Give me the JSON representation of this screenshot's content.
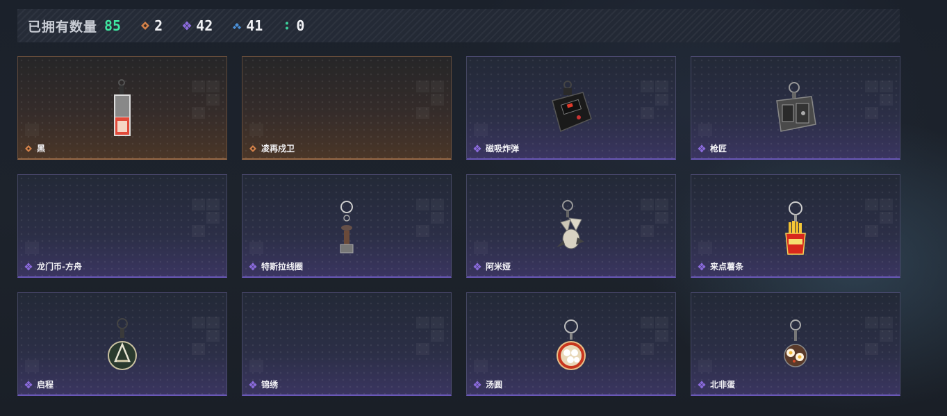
{
  "header": {
    "title": "已拥有数量",
    "total": "85",
    "stats": [
      {
        "icon": "orange-diamond-icon",
        "color": "#d4824a",
        "value": "2"
      },
      {
        "icon": "purple-diamond-icon",
        "color": "#8b6bdc",
        "value": "42"
      },
      {
        "icon": "blue-chevron-icon",
        "color": "#4a8fd8",
        "value": "41"
      },
      {
        "icon": "green-dots-icon",
        "color": "#3ccf9a",
        "value": "0"
      }
    ]
  },
  "items": [
    {
      "name": "黑",
      "rarity": "orange",
      "art": "card-keychain"
    },
    {
      "name": "凌再戍卫",
      "rarity": "orange",
      "art": "none"
    },
    {
      "name": "磁吸炸弹",
      "rarity": "purple",
      "art": "bomb-keychain"
    },
    {
      "name": "枪匠",
      "rarity": "purple",
      "art": "case-keychain"
    },
    {
      "name": "龙门币-方舟",
      "rarity": "purple",
      "art": "none"
    },
    {
      "name": "特斯拉线圈",
      "rarity": "purple",
      "art": "tesla-keychain"
    },
    {
      "name": "阿米娅",
      "rarity": "purple",
      "art": "amiya-keychain"
    },
    {
      "name": "来点薯条",
      "rarity": "purple",
      "art": "fries-keychain"
    },
    {
      "name": "启程",
      "rarity": "purple",
      "art": "medal-keychain"
    },
    {
      "name": "锦绣",
      "rarity": "purple",
      "art": "none"
    },
    {
      "name": "汤圆",
      "rarity": "purple",
      "art": "tangyuan-keychain"
    },
    {
      "name": "北非蛋",
      "rarity": "purple",
      "art": "shakshuka-keychain"
    }
  ],
  "colors": {
    "total": "#3ee6a0",
    "orange": "#d4824a",
    "purple": "#8b6bdc"
  }
}
